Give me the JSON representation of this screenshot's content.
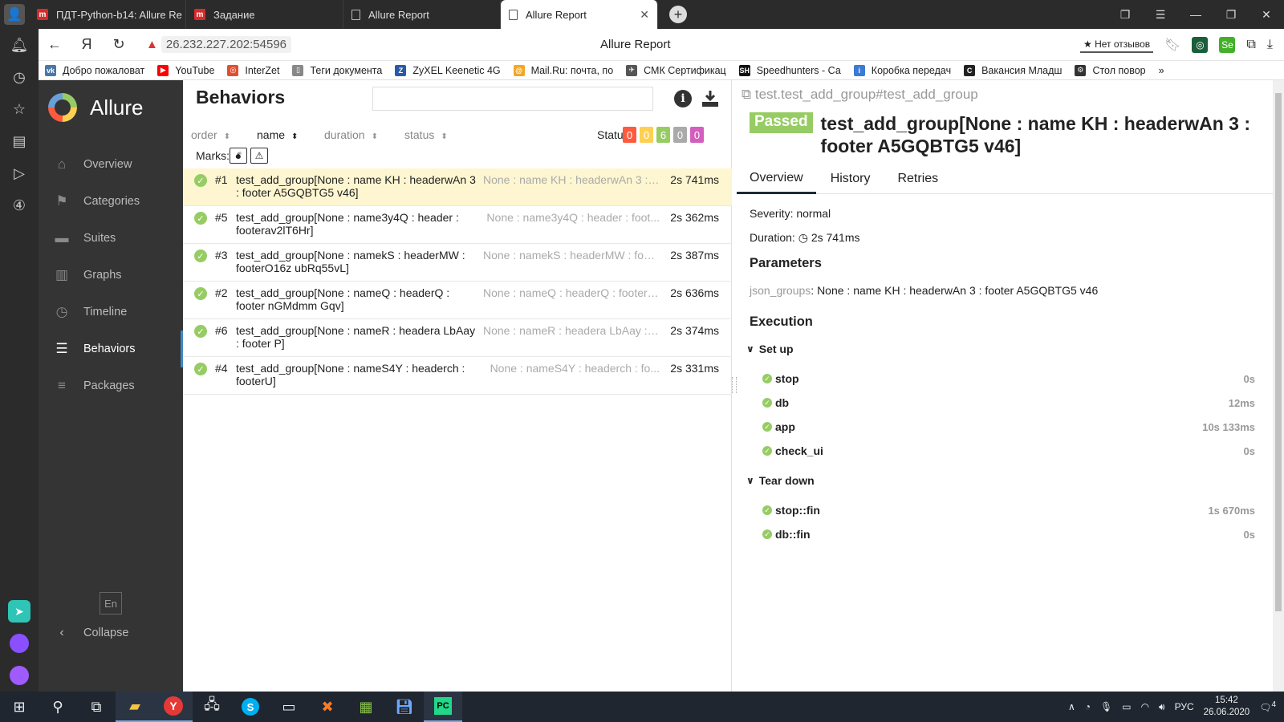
{
  "browser": {
    "tabs": [
      {
        "title": "ПДТ-Python-b14: Allure Re",
        "icon": "red-m-icon"
      },
      {
        "title": "Задание",
        "icon": "red-m-icon"
      },
      {
        "title": "Allure Report",
        "icon": "document-icon"
      },
      {
        "title": "Allure Report",
        "icon": "document-icon",
        "active": true
      }
    ],
    "url_warning": "▲",
    "url": "26.232.227.202:54596",
    "page_title": "Allure Report",
    "reviews_label": "★ Нет отзывов",
    "bookmarks": [
      {
        "label": "Добро пожаловат",
        "color": "#4a76a8",
        "glyph": "vk"
      },
      {
        "label": "YouTube",
        "color": "#ff0000",
        "glyph": "▶"
      },
      {
        "label": "InterZet",
        "color": "#e05030",
        "glyph": "◎"
      },
      {
        "label": "Теги документа",
        "color": "#888888",
        "glyph": "▯"
      },
      {
        "label": "ZyXEL Keenetic 4G",
        "color": "#2a5aa8",
        "glyph": "Z"
      },
      {
        "label": "Mail.Ru: почта, по",
        "color": "#f5a623",
        "glyph": "@"
      },
      {
        "label": "СМК Сертификац",
        "color": "#555555",
        "glyph": "✈"
      },
      {
        "label": "Speedhunters - Са",
        "color": "#111111",
        "glyph": "SH"
      },
      {
        "label": "Коробка передач",
        "color": "#3a7bd5",
        "glyph": "i"
      },
      {
        "label": "Вакансия Младш",
        "color": "#222222",
        "glyph": "C"
      },
      {
        "label": "Стол повор",
        "color": "#333333",
        "glyph": "⚙"
      }
    ]
  },
  "allure": {
    "logo_text": "Allure",
    "nav": [
      {
        "label": "Overview",
        "icon": "home-icon",
        "glyph": "⌂"
      },
      {
        "label": "Categories",
        "icon": "flag-icon",
        "glyph": "⚑"
      },
      {
        "label": "Suites",
        "icon": "briefcase-icon",
        "glyph": "▬"
      },
      {
        "label": "Graphs",
        "icon": "bar-chart-icon",
        "glyph": "▥"
      },
      {
        "label": "Timeline",
        "icon": "clock-icon",
        "glyph": "◷"
      },
      {
        "label": "Behaviors",
        "icon": "list-icon",
        "glyph": "☰",
        "active": true
      },
      {
        "label": "Packages",
        "icon": "align-left-icon",
        "glyph": "≡"
      }
    ],
    "lang": "En",
    "collapse_label": "Collapse"
  },
  "behaviors": {
    "title": "Behaviors",
    "sort": {
      "order": "order",
      "name": "name",
      "duration": "duration",
      "status": "status"
    },
    "status_label": "Status:",
    "status_counts": [
      {
        "value": "0",
        "color": "#fd5a3e"
      },
      {
        "value": "0",
        "color": "#ffd050"
      },
      {
        "value": "6",
        "color": "#97cc64"
      },
      {
        "value": "0",
        "color": "#aaaaaa"
      },
      {
        "value": "0",
        "color": "#d35ebe"
      }
    ],
    "marks_label": "Marks:",
    "rows": [
      {
        "num": "#1",
        "name": "test_add_group[None : name KH : headerwAn 3 : footer A5GQBTG5 v46]",
        "params": "None : name KH : headerwAn 3 : f...",
        "duration": "2s 741ms",
        "selected": true
      },
      {
        "num": "#5",
        "name": "test_add_group[None : name3y4Q : header : footerav2lT6Hr]",
        "params": "None : name3y4Q : header : foot...",
        "duration": "2s 362ms"
      },
      {
        "num": "#3",
        "name": "test_add_group[None : namekS : headerMW : footerO16z ubRq55vL]",
        "params": "None : namekS : headerMW : foot...",
        "duration": "2s 387ms"
      },
      {
        "num": "#2",
        "name": "test_add_group[None : nameQ : headerQ : footer nGMdmm Gqv]",
        "params": "None : nameQ : headerQ : footer ...",
        "duration": "2s 636ms"
      },
      {
        "num": "#6",
        "name": "test_add_group[None : nameR : headera LbAay : footer P]",
        "params": "None : nameR : headera LbAay : ...",
        "duration": "2s 374ms"
      },
      {
        "num": "#4",
        "name": "test_add_group[None : nameS4Y : headerch : footerU]",
        "params": "None : nameS4Y : headerch : fo...",
        "duration": "2s 331ms"
      }
    ]
  },
  "detail": {
    "path": "test.test_add_group#test_add_group",
    "status": "Passed",
    "name": "test_add_group[None : name KH : headerwAn 3 : footer A5GQBTG5 v46]",
    "tabs": [
      "Overview",
      "History",
      "Retries"
    ],
    "severity_label": "Severity:",
    "severity": "normal",
    "duration_label": "Duration:",
    "duration": "2s 741ms",
    "parameters_title": "Parameters",
    "param_key": "json_groups",
    "param_value": "None : name KH : headerwAn 3 : footer A5GQBTG5 v46",
    "execution_title": "Execution",
    "setup_label": "Set up",
    "setup_steps": [
      {
        "name": "stop",
        "time": "0s"
      },
      {
        "name": "db",
        "time": "12ms"
      },
      {
        "name": "app",
        "time": "10s 133ms"
      },
      {
        "name": "check_ui",
        "time": "0s"
      }
    ],
    "teardown_label": "Tear down",
    "teardown_steps": [
      {
        "name": "stop::fin",
        "time": "1s 670ms"
      },
      {
        "name": "db::fin",
        "time": "0s"
      }
    ]
  },
  "taskbar": {
    "lang": "РУС",
    "time": "15:42",
    "date": "26.06.2020",
    "notif_count": "4"
  }
}
